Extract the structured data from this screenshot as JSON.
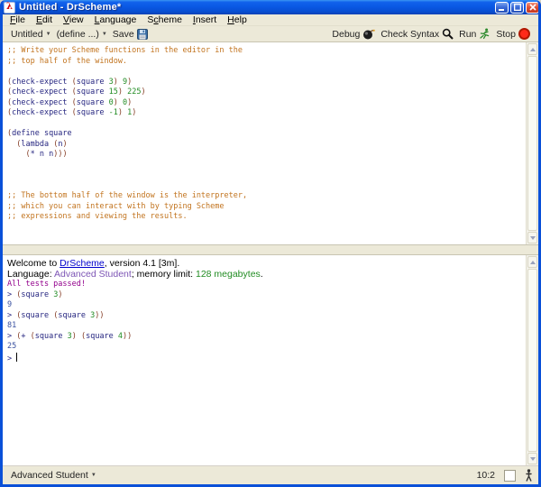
{
  "window": {
    "title": "Untitled - DrScheme*",
    "icon_glyph": "λ"
  },
  "icons": {
    "dropdown_arrow": "▼"
  },
  "colors": {
    "titlebar_blue": "#0a58e4",
    "frame_blue": "#0a50d8",
    "chrome_beige": "#ece9d8",
    "comment": "#c2741f",
    "identifier": "#262680",
    "number": "#228c23",
    "paren": "#843c24",
    "output": "#3a51a0",
    "test_passed": "#93008c",
    "language_name": "#7d55b5",
    "link": "#0000cc"
  },
  "menu": {
    "items": [
      {
        "pre": "",
        "u": "F",
        "rest": "ile"
      },
      {
        "pre": "",
        "u": "E",
        "rest": "dit"
      },
      {
        "pre": "",
        "u": "V",
        "rest": "iew"
      },
      {
        "pre": "",
        "u": "L",
        "rest": "anguage"
      },
      {
        "pre": "S",
        "u": "c",
        "rest": "heme"
      },
      {
        "pre": "",
        "u": "I",
        "rest": "nsert"
      },
      {
        "pre": "",
        "u": "H",
        "rest": "elp"
      }
    ]
  },
  "toolbar": {
    "untitled_label": "Untitled",
    "define_label": "(define ...)",
    "save_label": "Save",
    "debug_label": "Debug",
    "check_syntax_label": "Check Syntax",
    "run_label": "Run",
    "stop_label": "Stop"
  },
  "editor": {
    "lines": [
      {
        "tokens": [
          {
            "c": "com",
            "t": ";; Write your Scheme functions in the editor in the"
          }
        ]
      },
      {
        "tokens": [
          {
            "c": "com",
            "t": ";; top half of the window."
          }
        ]
      },
      {
        "tokens": []
      },
      {
        "tokens": [
          {
            "c": "par",
            "t": "("
          },
          {
            "c": "id",
            "t": "check-expect "
          },
          {
            "c": "par",
            "t": "("
          },
          {
            "c": "id",
            "t": "square "
          },
          {
            "c": "num",
            "t": "3"
          },
          {
            "c": "par",
            "t": ")"
          },
          {
            "c": "id",
            "t": " "
          },
          {
            "c": "num",
            "t": "9"
          },
          {
            "c": "par",
            "t": ")"
          }
        ]
      },
      {
        "tokens": [
          {
            "c": "par",
            "t": "("
          },
          {
            "c": "id",
            "t": "check-expect "
          },
          {
            "c": "par",
            "t": "("
          },
          {
            "c": "id",
            "t": "square "
          },
          {
            "c": "num",
            "t": "15"
          },
          {
            "c": "par",
            "t": ")"
          },
          {
            "c": "id",
            "t": " "
          },
          {
            "c": "num",
            "t": "225"
          },
          {
            "c": "par",
            "t": ")"
          }
        ]
      },
      {
        "tokens": [
          {
            "c": "par",
            "t": "("
          },
          {
            "c": "id",
            "t": "check-expect "
          },
          {
            "c": "par",
            "t": "("
          },
          {
            "c": "id",
            "t": "square "
          },
          {
            "c": "num",
            "t": "0"
          },
          {
            "c": "par",
            "t": ")"
          },
          {
            "c": "id",
            "t": " "
          },
          {
            "c": "num",
            "t": "0"
          },
          {
            "c": "par",
            "t": ")"
          }
        ]
      },
      {
        "tokens": [
          {
            "c": "par",
            "t": "("
          },
          {
            "c": "id",
            "t": "check-expect "
          },
          {
            "c": "par",
            "t": "("
          },
          {
            "c": "id",
            "t": "square "
          },
          {
            "c": "num",
            "t": "-1"
          },
          {
            "c": "par",
            "t": ")"
          },
          {
            "c": "id",
            "t": " "
          },
          {
            "c": "num",
            "t": "1"
          },
          {
            "c": "par",
            "t": ")"
          }
        ]
      },
      {
        "tokens": []
      },
      {
        "tokens": [
          {
            "c": "par",
            "t": "("
          },
          {
            "c": "id",
            "t": "define square"
          }
        ]
      },
      {
        "tokens": [
          {
            "c": "id",
            "t": "  "
          },
          {
            "c": "par",
            "t": "("
          },
          {
            "c": "id",
            "t": "lambda "
          },
          {
            "c": "par",
            "t": "("
          },
          {
            "c": "id",
            "t": "n"
          },
          {
            "c": "par",
            "t": ")"
          }
        ]
      },
      {
        "tokens": [
          {
            "c": "id",
            "t": "    "
          },
          {
            "c": "par",
            "t": "("
          },
          {
            "c": "id",
            "t": "* n n"
          },
          {
            "c": "par",
            "t": ")))"
          }
        ]
      },
      {
        "tokens": []
      },
      {
        "tokens": []
      },
      {
        "tokens": []
      },
      {
        "tokens": [
          {
            "c": "com",
            "t": ";; The bottom half of the window is the interpreter,"
          }
        ]
      },
      {
        "tokens": [
          {
            "c": "com",
            "t": ";; which you can interact with by typing Scheme"
          }
        ]
      },
      {
        "tokens": [
          {
            "c": "com",
            "t": ";; expressions and viewing the results."
          }
        ]
      }
    ]
  },
  "repl": {
    "lines": [
      {
        "cls": "sans",
        "tokens": [
          {
            "c": "txt",
            "t": "Welcome to "
          },
          {
            "c": "link",
            "t": "DrScheme"
          },
          {
            "c": "txt",
            "t": ", version 4.1 [3m]."
          }
        ]
      },
      {
        "cls": "sans",
        "tokens": [
          {
            "c": "txt",
            "t": "Language: "
          },
          {
            "c": "lang",
            "t": "Advanced Student"
          },
          {
            "c": "txt",
            "t": "; memory limit: "
          },
          {
            "c": "num",
            "t": "128 megabytes"
          },
          {
            "c": "txt",
            "t": "."
          }
        ]
      },
      {
        "tokens": [
          {
            "c": "test",
            "t": "All tests passed!"
          }
        ]
      },
      {
        "tokens": [
          {
            "c": "prompt",
            "t": "> "
          },
          {
            "c": "par",
            "t": "("
          },
          {
            "c": "id",
            "t": "square "
          },
          {
            "c": "num",
            "t": "3"
          },
          {
            "c": "par",
            "t": ")"
          }
        ]
      },
      {
        "tokens": [
          {
            "c": "out",
            "t": "9"
          }
        ]
      },
      {
        "tokens": [
          {
            "c": "prompt",
            "t": "> "
          },
          {
            "c": "par",
            "t": "("
          },
          {
            "c": "id",
            "t": "square "
          },
          {
            "c": "par",
            "t": "("
          },
          {
            "c": "id",
            "t": "square "
          },
          {
            "c": "num",
            "t": "3"
          },
          {
            "c": "par",
            "t": "))"
          }
        ]
      },
      {
        "tokens": [
          {
            "c": "out",
            "t": "81"
          }
        ]
      },
      {
        "tokens": [
          {
            "c": "prompt",
            "t": "> "
          },
          {
            "c": "par",
            "t": "("
          },
          {
            "c": "id",
            "t": "+ "
          },
          {
            "c": "par",
            "t": "("
          },
          {
            "c": "id",
            "t": "square "
          },
          {
            "c": "num",
            "t": "3"
          },
          {
            "c": "par",
            "t": ") "
          },
          {
            "c": "par",
            "t": "("
          },
          {
            "c": "id",
            "t": "square "
          },
          {
            "c": "num",
            "t": "4"
          },
          {
            "c": "par",
            "t": "))"
          }
        ]
      },
      {
        "tokens": [
          {
            "c": "out",
            "t": "25"
          }
        ]
      },
      {
        "tokens": [
          {
            "c": "prompt",
            "t": "> "
          },
          {
            "c": "cursor",
            "t": ""
          }
        ]
      }
    ]
  },
  "statusbar": {
    "language": "Advanced Student",
    "position": "10:2"
  }
}
